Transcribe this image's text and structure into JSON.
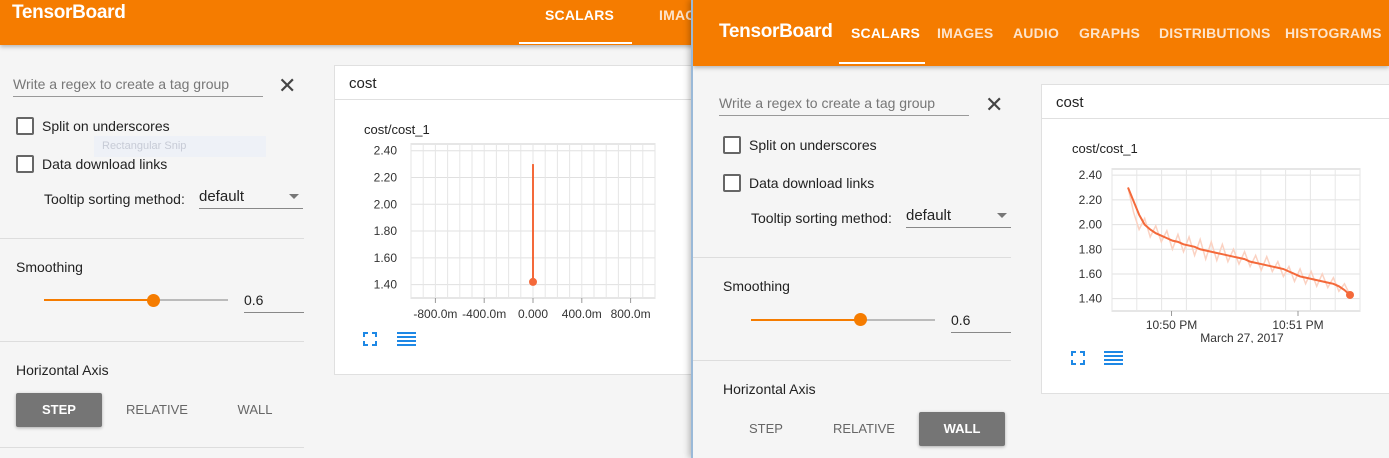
{
  "brand": "TensorBoard",
  "tabs": [
    "SCALARS",
    "IMAGES",
    "AUDIO",
    "GRAPHS",
    "DISTRIBUTIONS",
    "HISTOGRAMS"
  ],
  "tab_clipped": "IMAG",
  "sidebar": {
    "regex_placeholder": "Write a regex to create a tag group",
    "split_label": "Split on underscores",
    "download_label": "Data download links",
    "tooltip_label": "Tooltip sorting method:",
    "tooltip_value": "default",
    "smoothing_label": "Smoothing",
    "smoothing_value": "0.6",
    "haxis_label": "Horizontal Axis",
    "haxis_options": [
      "STEP",
      "RELATIVE",
      "WALL"
    ]
  },
  "ghost_text": "Rectangular Snip",
  "colors": {
    "accent": "#f57c00",
    "line": "#f4693a",
    "raw": "#fbd2c2"
  },
  "icons": [
    "fullscreen-icon",
    "data-list-icon",
    "close-icon",
    "dropdown-caret-icon"
  ],
  "windowA": {
    "group": "cost",
    "haxis_selected": "STEP",
    "chart_data": {
      "type": "line",
      "title": "cost/cost_1",
      "x_tick_labels": [
        "-800.0m",
        "-400.0m",
        "0.000",
        "400.0m",
        "800.0m"
      ],
      "y_tick_labels": [
        "2.40",
        "2.20",
        "2.00",
        "1.80",
        "1.60",
        "1.40"
      ],
      "xlim": [
        -1.0,
        1.0
      ],
      "ylim": [
        1.3,
        2.45
      ],
      "grid": true,
      "series": [
        {
          "x": [
            0.0,
            0.0
          ],
          "y": [
            2.3,
            1.42
          ]
        }
      ]
    }
  },
  "windowB": {
    "group": "cost",
    "haxis_selected": "WALL",
    "chart_data": {
      "type": "line",
      "title": "cost/cost_1",
      "x_tick_labels": [
        "10:50 PM",
        "10:51 PM"
      ],
      "x_sublabel": "March 27, 2017",
      "y_tick_labels": [
        "2.40",
        "2.20",
        "2.00",
        "1.80",
        "1.60",
        "1.40"
      ],
      "ylim": [
        1.3,
        2.45
      ],
      "grid": true,
      "series": [
        {
          "role": "smoothed",
          "y": [
            2.3,
            2.19,
            2.08,
            2.0,
            1.96,
            1.93,
            1.91,
            1.89,
            1.87,
            1.86,
            1.84,
            1.83,
            1.82,
            1.8,
            1.79,
            1.78,
            1.77,
            1.76,
            1.75,
            1.74,
            1.73,
            1.72,
            1.7,
            1.69,
            1.68,
            1.67,
            1.66,
            1.65,
            1.64,
            1.62,
            1.6,
            1.58,
            1.57,
            1.56,
            1.55,
            1.54,
            1.53,
            1.52,
            1.5,
            1.47,
            1.43
          ]
        },
        {
          "role": "raw",
          "y": [
            2.3,
            2.1,
            1.96,
            2.05,
            1.9,
            1.99,
            1.86,
            1.95,
            1.8,
            1.92,
            1.78,
            1.9,
            1.75,
            1.88,
            1.72,
            1.86,
            1.71,
            1.84,
            1.7,
            1.8,
            1.68,
            1.78,
            1.66,
            1.75,
            1.63,
            1.74,
            1.62,
            1.7,
            1.58,
            1.66,
            1.54,
            1.64,
            1.52,
            1.62,
            1.5,
            1.6,
            1.49,
            1.57,
            1.46,
            1.52,
            1.43
          ]
        }
      ]
    }
  }
}
